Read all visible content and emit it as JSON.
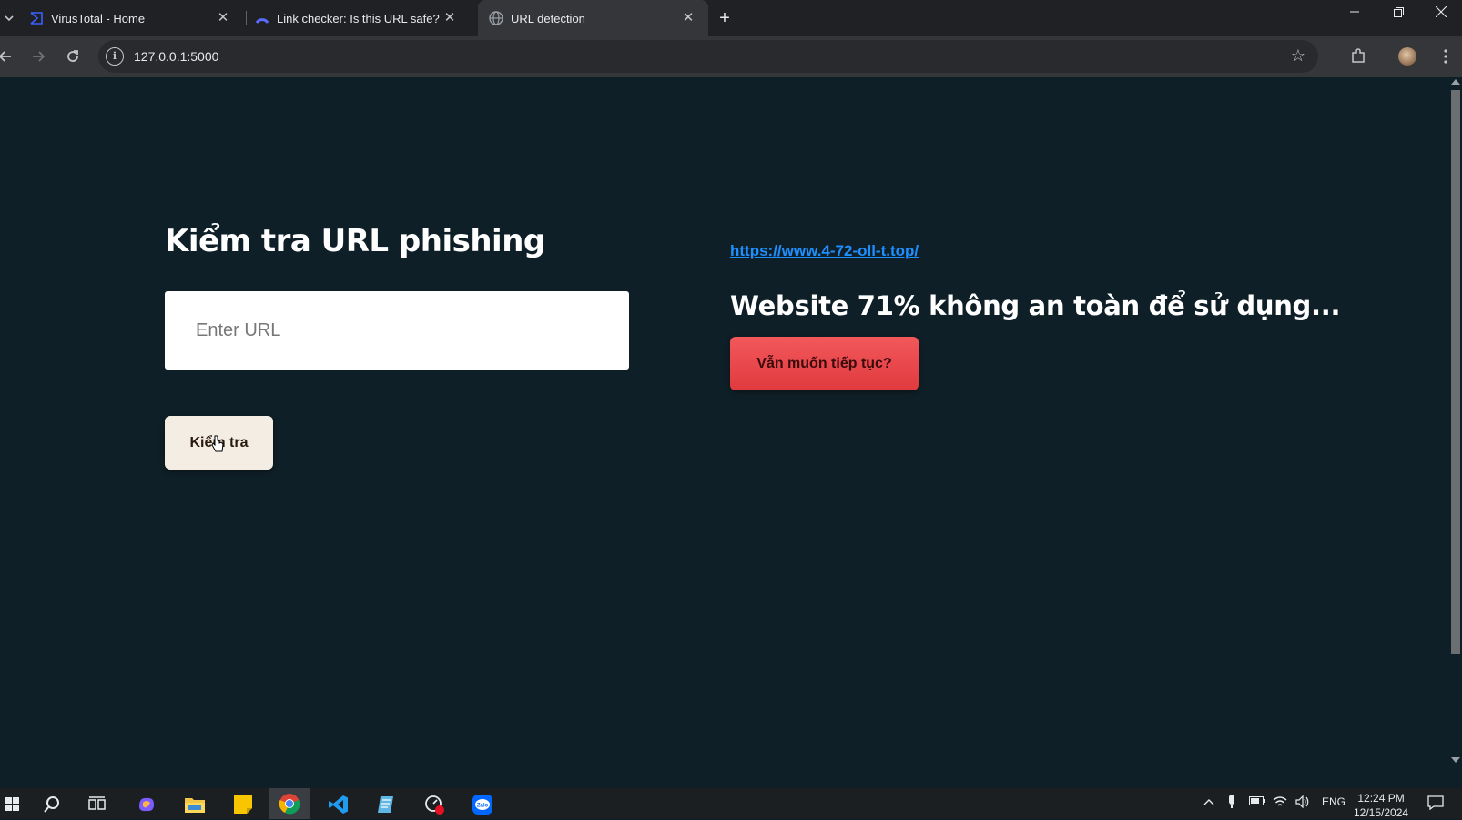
{
  "browser": {
    "tabs": [
      {
        "title": "VirusTotal - Home",
        "icon": "virustotal-icon"
      },
      {
        "title": "Link checker: Is this URL safe? |",
        "icon": "link-checker-icon"
      },
      {
        "title": "URL detection",
        "icon": "globe-icon"
      }
    ],
    "address": "127.0.0.1:5000"
  },
  "page": {
    "title": "Kiểm tra URL phishing",
    "input_placeholder": "Enter URL",
    "check_button": "Kiểm tra",
    "result_url": "https://www.4-72-oll-t.top/",
    "result_message": "Website 71% không an toàn để sử dụng...",
    "continue_button": "Vẫn muốn tiếp tục?"
  },
  "taskbar": {
    "language": "ENG",
    "time": "12:24 PM",
    "date": "12/15/2024"
  },
  "colors": {
    "page_background": "#0f1f27",
    "link": "#1e8fff",
    "danger_button": "#e94347",
    "check_button": "#f4ede3"
  }
}
